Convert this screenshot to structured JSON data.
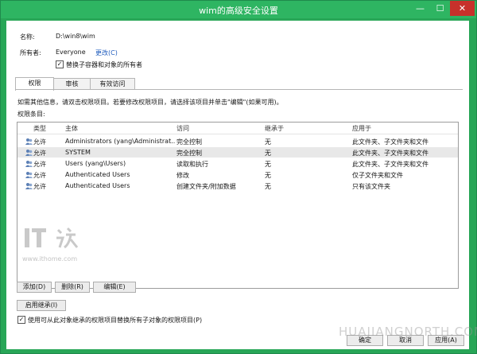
{
  "window": {
    "title": "wim的高级安全设置",
    "min": "—",
    "max": "☐",
    "close": "✕"
  },
  "info": {
    "name_label": "名称:",
    "name_value": "D:\\win8\\wim",
    "owner_label": "所有者:",
    "owner_value": "Everyone",
    "change_link": "更改(C)",
    "replace_owner_label": "替换子容器和对象的所有者"
  },
  "tabs": [
    {
      "label": "权限"
    },
    {
      "label": "审核"
    },
    {
      "label": "有效访问"
    }
  ],
  "hint": "如需其他信息，请双击权限项目。若要修改权限项目，请选择该项目并单击\"编辑\"(如果可用)。",
  "entries_label": "权限条目:",
  "columns": [
    "类型",
    "主体",
    "访问",
    "继承于",
    "应用于"
  ],
  "rows": [
    [
      "允许",
      "Administrators (yang\\Administrat...",
      "完全控制",
      "无",
      "此文件夹、子文件夹和文件"
    ],
    [
      "允许",
      "SYSTEM",
      "完全控制",
      "无",
      "此文件夹、子文件夹和文件"
    ],
    [
      "允许",
      "Users (yang\\Users)",
      "读取和执行",
      "无",
      "此文件夹、子文件夹和文件"
    ],
    [
      "允许",
      "Authenticated Users",
      "修改",
      "无",
      "仅子文件夹和文件"
    ],
    [
      "允许",
      "Authenticated Users",
      "创建文件夹/附加数据",
      "无",
      "只有该文件夹"
    ]
  ],
  "buttons": {
    "add": "添加(D)",
    "remove": "删除(R)",
    "edit": "编辑(E)",
    "inherit": "启用继承(I)"
  },
  "replace_children_label": "使用可从此对象继承的权限项目替换所有子对象的权限项目(P)",
  "footer": {
    "ok": "确定",
    "cancel": "取消",
    "apply": "应用(A)"
  },
  "watermarks": {
    "logo": "IT之家",
    "url": "www.ithome.com",
    "brand": "HUAJIANGNORTH.COM"
  },
  "colors": {
    "frame": "#2eb562",
    "close": "#c7312b",
    "link": "#1e5bbd"
  }
}
